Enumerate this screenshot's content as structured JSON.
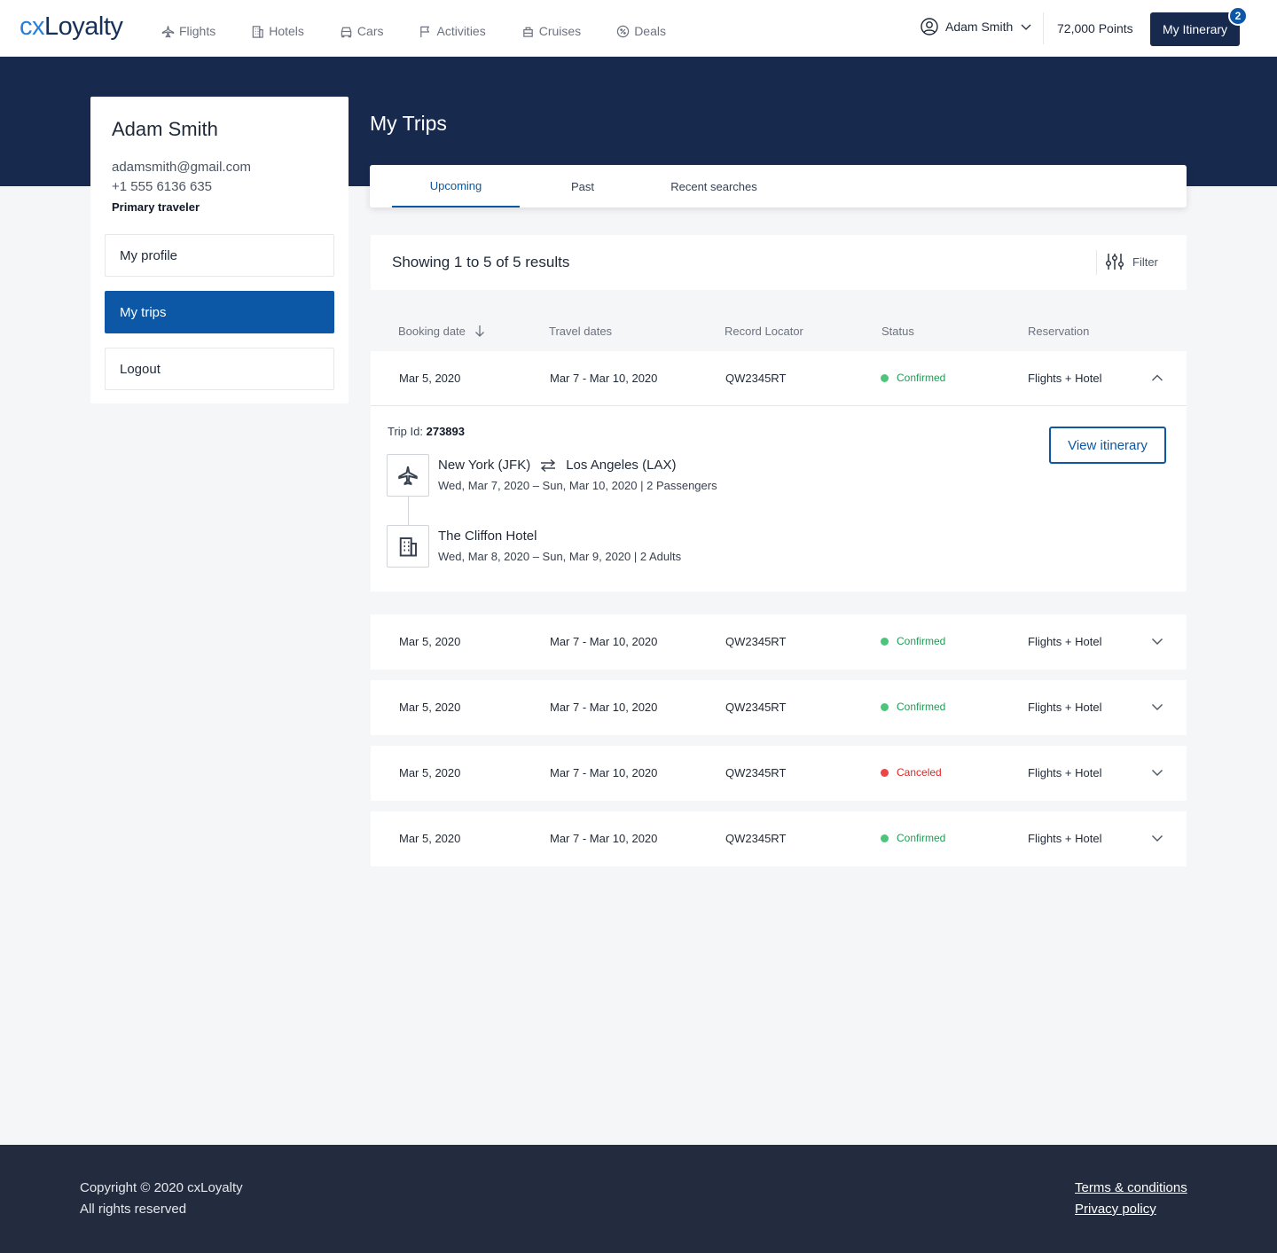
{
  "brand": {
    "prefix": "cx",
    "name": "Loyalty"
  },
  "nav": {
    "links": [
      {
        "label": "Flights",
        "icon": "plane-icon"
      },
      {
        "label": "Hotels",
        "icon": "building-icon"
      },
      {
        "label": "Cars",
        "icon": "car-icon"
      },
      {
        "label": "Activities",
        "icon": "flag-icon"
      },
      {
        "label": "Cruises",
        "icon": "ship-icon"
      },
      {
        "label": "Deals",
        "icon": "percent-icon"
      }
    ],
    "user_name": "Adam Smith",
    "points": "72,000 Points",
    "itinerary_label": "My Itinerary",
    "itinerary_count": "2"
  },
  "sidebar": {
    "name": "Adam Smith",
    "email": "adamsmith@gmail.com",
    "phone": "+1 555 6136 635",
    "role": "Primary traveler",
    "items": [
      {
        "label": "My profile",
        "active": false
      },
      {
        "label": "My trips",
        "active": true
      },
      {
        "label": "Logout",
        "active": false
      }
    ]
  },
  "main": {
    "title": "My Trips",
    "tabs": [
      {
        "label": "Upcoming",
        "active": true
      },
      {
        "label": "Past",
        "active": false
      },
      {
        "label": "Recent searches",
        "active": false
      }
    ],
    "results_text": "Showing 1 to 5 of 5 results",
    "filter_label": "Filter",
    "columns": [
      "Booking date",
      "Travel dates",
      "Record Locator",
      "Status",
      "Reservation"
    ]
  },
  "trips": [
    {
      "booking_date": "Mar 5, 2020",
      "travel_dates": "Mar 7 - Mar 10, 2020",
      "locator": "QW2345RT",
      "status": "Confirmed",
      "reservation": "Flights + Hotel",
      "expanded": true
    },
    {
      "booking_date": "Mar 5, 2020",
      "travel_dates": "Mar 7 - Mar 10, 2020",
      "locator": "QW2345RT",
      "status": "Confirmed",
      "reservation": "Flights + Hotel",
      "expanded": false
    },
    {
      "booking_date": "Mar 5, 2020",
      "travel_dates": "Mar 7 - Mar 10, 2020",
      "locator": "QW2345RT",
      "status": "Confirmed",
      "reservation": "Flights + Hotel",
      "expanded": false
    },
    {
      "booking_date": "Mar 5, 2020",
      "travel_dates": "Mar 7 - Mar 10, 2020",
      "locator": "QW2345RT",
      "status": "Canceled",
      "reservation": "Flights + Hotel",
      "expanded": false
    },
    {
      "booking_date": "Mar 5, 2020",
      "travel_dates": "Mar 7 - Mar 10, 2020",
      "locator": "QW2345RT",
      "status": "Confirmed",
      "reservation": "Flights + Hotel",
      "expanded": false
    }
  ],
  "details": {
    "trip_id_label": "Trip Id:",
    "trip_id": "273893",
    "view_label": "View itinerary",
    "flight": {
      "from": "New York (JFK)",
      "to": "Los Angeles (LAX)",
      "sub": "Wed, Mar 7, 2020 – Sun, Mar 10, 2020 | 2 Passengers"
    },
    "hotel": {
      "name": "The Cliffon Hotel",
      "sub": "Wed, Mar 8, 2020 – Sun, Mar 9, 2020 | 2 Adults"
    }
  },
  "status_colors": {
    "Confirmed": "#4cc57a",
    "Canceled": "#ef4444"
  },
  "status_text_colors": {
    "Confirmed": "#1f9d55",
    "Canceled": "#e02424"
  },
  "footer": {
    "copyright": "Copyright © 2020 cxLoyalty",
    "rights": "All rights reserved",
    "terms": "Terms & conditions",
    "privacy": "Privacy policy"
  }
}
